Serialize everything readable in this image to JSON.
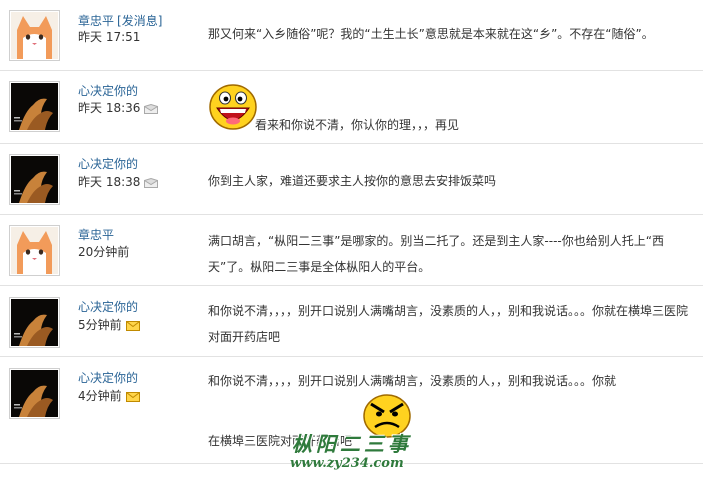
{
  "messages": [
    {
      "name": "章忠平",
      "tag": "[发消息]",
      "time": "昨天 17:51",
      "text": "那又何来“入乡随俗”呢？我的“土生土长”意思就是本来就在这“乡”。不存在“随俗”。"
    },
    {
      "name": "心决定你的",
      "time": "昨天 18:36",
      "text": "看来和你说不清，你认你的理，，，再见"
    },
    {
      "name": "心决定你的",
      "time": "昨天 18:38",
      "text": "你到主人家，难道还要求主人按你的意思去安排饭菜吗"
    },
    {
      "name": "章忠平",
      "time": "20分钟前",
      "text": "满口胡言，“枞阳二三事”是哪家的。别当二托了。还是到主人家----你也给别人托上“西天”了。枞阳二三事是全体枞阳人的平台。"
    },
    {
      "name": "心决定你的",
      "time": "5分钟前",
      "text": "和你说不清，，，，别开口说别人满嘴胡言，没素质的人，，别和我说话。。。你就在横埠三医院对面开药店吧"
    },
    {
      "name": "心决定你的",
      "time": "4分钟前",
      "text_line1": "和你说不清，，，，别开口说别人满嘴胡言，没素质的人，，别和我说话。。。你就",
      "text_line2": "在横埠三医院对面开药店吧"
    }
  ],
  "watermark": {
    "title": "枞阳二三事",
    "url": "www.zy234.com"
  },
  "icons": {
    "mail_read": "envelope-open-icon",
    "mail_unread": "envelope-unread-icon",
    "smiley_laugh": "laughing-smiley-icon",
    "smiley_angry": "angry-smiley-icon"
  }
}
